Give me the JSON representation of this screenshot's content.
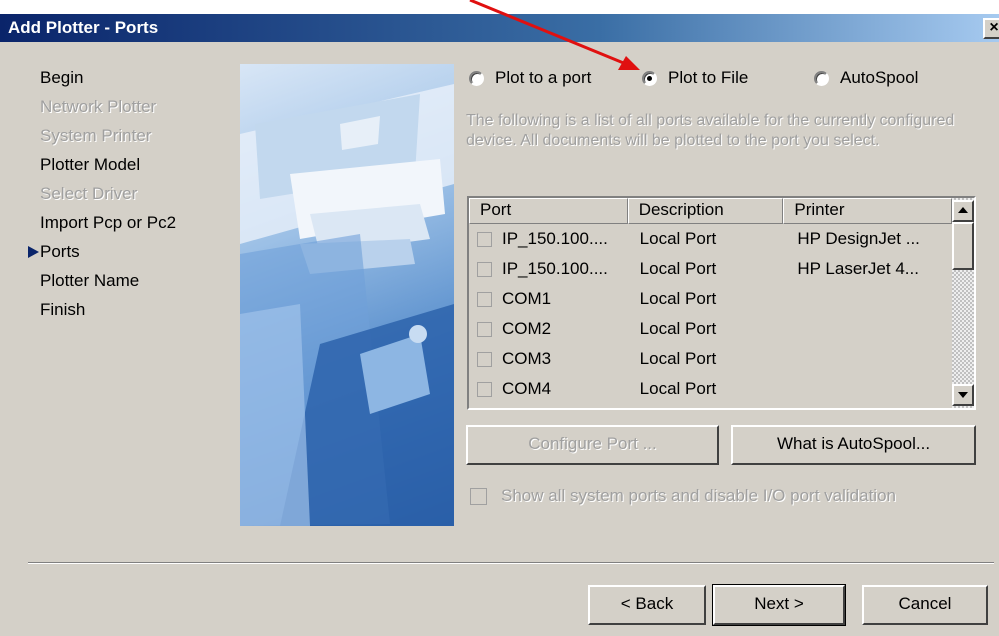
{
  "window": {
    "title": "Add Plotter - Ports",
    "close_label": "×"
  },
  "steps": [
    {
      "label": "Begin",
      "state": "enabled"
    },
    {
      "label": "Network Plotter",
      "state": "disabled"
    },
    {
      "label": "System Printer",
      "state": "disabled"
    },
    {
      "label": "Plotter Model",
      "state": "enabled"
    },
    {
      "label": "Select Driver",
      "state": "disabled"
    },
    {
      "label": "Import Pcp or Pc2",
      "state": "enabled"
    },
    {
      "label": "Ports",
      "state": "current"
    },
    {
      "label": "Plotter Name",
      "state": "enabled"
    },
    {
      "label": "Finish",
      "state": "enabled"
    }
  ],
  "radios": [
    {
      "label": "Plot to a port",
      "selected": false
    },
    {
      "label": "Plot to File",
      "selected": true
    },
    {
      "label": "AutoSpool",
      "selected": false
    }
  ],
  "description": "The following is a list of all ports available for the currently configured device. All documents will be plotted to the port you select.",
  "ports_list": {
    "columns": [
      "Port",
      "Description",
      "Printer"
    ],
    "rows": [
      {
        "port": "IP_150.100....",
        "description": "Local Port",
        "printer": "HP DesignJet ..."
      },
      {
        "port": "IP_150.100....",
        "description": "Local Port",
        "printer": "HP LaserJet 4..."
      },
      {
        "port": "COM1",
        "description": "Local Port",
        "printer": ""
      },
      {
        "port": "COM2",
        "description": "Local Port",
        "printer": ""
      },
      {
        "port": "COM3",
        "description": "Local Port",
        "printer": ""
      },
      {
        "port": "COM4",
        "description": "Local Port",
        "printer": ""
      }
    ]
  },
  "buttons": {
    "configure_port": "Configure Port ...",
    "what_is_autospool": "What is AutoSpool...",
    "back": "< Back",
    "next": "Next >",
    "cancel": "Cancel"
  },
  "show_all_label": "Show all system ports and disable I/O port validation",
  "colors": {
    "accent_arrow": "#e01010",
    "title_bar": "#0a246a",
    "dialog_face": "#d4d0c8"
  }
}
